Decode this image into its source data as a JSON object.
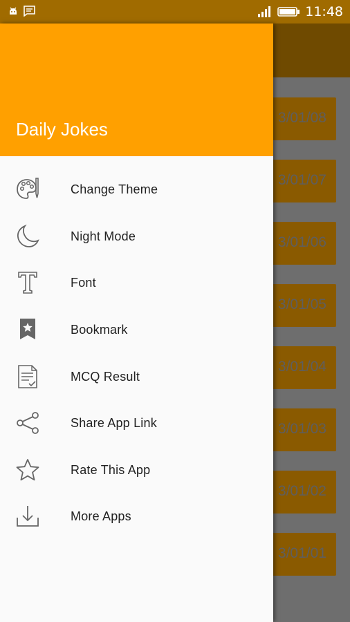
{
  "status_bar": {
    "time": "11:48",
    "icons": [
      "android-icon",
      "message-icon",
      "signal-icon",
      "battery-icon"
    ]
  },
  "background": {
    "dates": [
      "3/01/08",
      "3/01/07",
      "3/01/06",
      "3/01/05",
      "3/01/04",
      "3/01/03",
      "3/01/02",
      "3/01/01"
    ]
  },
  "drawer": {
    "title": "Daily Jokes",
    "items": [
      {
        "label": "Change Theme",
        "icon": "palette-icon"
      },
      {
        "label": "Night Mode",
        "icon": "moon-icon"
      },
      {
        "label": "Font",
        "icon": "font-icon"
      },
      {
        "label": "Bookmark",
        "icon": "bookmark-icon"
      },
      {
        "label": "MCQ Result",
        "icon": "document-check-icon"
      },
      {
        "label": "Share App Link",
        "icon": "share-icon"
      },
      {
        "label": "Rate This App",
        "icon": "star-icon"
      },
      {
        "label": "More Apps",
        "icon": "download-icon"
      }
    ],
    "colors": {
      "header": "#ffa000",
      "background": "#fafafa",
      "text": "#222222"
    }
  }
}
